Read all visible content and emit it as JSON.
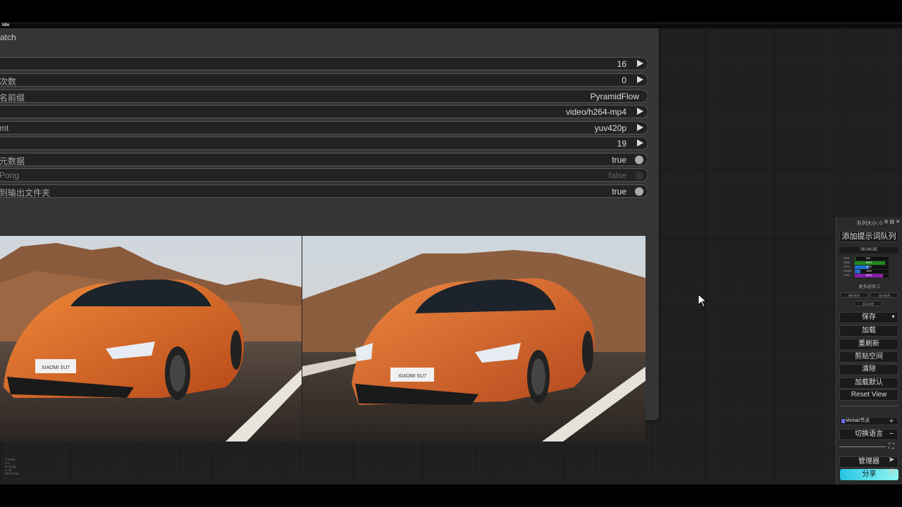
{
  "top_strip": {
    "status": "Idle"
  },
  "node": {
    "title": "atch",
    "widgets": [
      {
        "label": "",
        "value": "16",
        "kind": "arrow"
      },
      {
        "label": "次数",
        "value": "0",
        "kind": "arrow"
      },
      {
        "label": "名前缀",
        "value": "PyramidFlow",
        "kind": "text"
      },
      {
        "label": "",
        "value": "video/h264-mp4",
        "kind": "arrow"
      },
      {
        "label": "mt",
        "value": "yuv420p",
        "kind": "arrow"
      },
      {
        "label": "",
        "value": "19",
        "kind": "arrow"
      },
      {
        "label": "元数据",
        "value": "true",
        "kind": "toggle-on"
      },
      {
        "label": "Pong",
        "value": "false",
        "kind": "toggle-off"
      },
      {
        "label": "到输出文件夹",
        "value": "true",
        "kind": "toggle-on"
      }
    ]
  },
  "preview": {
    "left_plate": "XIAOMI SU7",
    "right_plate": "XIAOMI SU7"
  },
  "panel": {
    "title": "队列大小: 0",
    "header_icons": "⚙ ▤ ✕",
    "add_queue": "添加提示词队列",
    "timer": "00:04:35",
    "meters": [
      {
        "label": "CPU",
        "value": "3%",
        "pct": 3,
        "color": "#1e8a1e"
      },
      {
        "label": "RAM",
        "value": "89%",
        "pct": 89,
        "color": "#1e8a1e"
      },
      {
        "label": "GPU",
        "value": "42%",
        "pct": 42,
        "color": "#1e6fd1"
      },
      {
        "label": "VRAM",
        "value": "16%",
        "pct": 16,
        "color": "#1e6fd1"
      },
      {
        "label": "HDD",
        "value": "84%",
        "pct": 84,
        "color": "#8a1eb0"
      }
    ],
    "more_options": "更多选项 ☐",
    "queue_btn": "执行队列",
    "history_btn": "显示队列",
    "view_history": "显示历史",
    "save": "保存",
    "load": "加载",
    "refresh": "重刷新",
    "clipspace": "剪贴空间",
    "clear": "清除",
    "load_default": "加载默认",
    "reset_view": "Reset View",
    "mixlab": "Mixlab节点",
    "switch_lang": "切换语言",
    "manager": "管理器",
    "share": "分享"
  },
  "side_icons": [
    "+",
    "−",
    "⛶",
    "➤",
    "👁"
  ],
  "stats": [
    "T: 0.00s",
    "I: 0",
    "N: 11 [2]",
    "V: 23",
    "FPS:77.52"
  ]
}
